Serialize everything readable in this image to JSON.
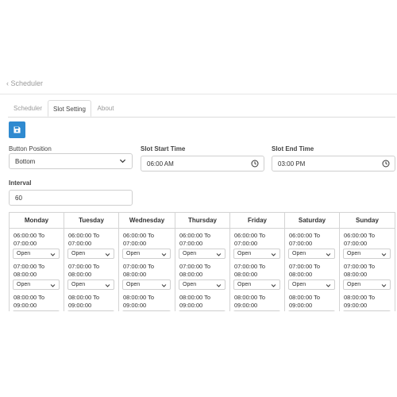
{
  "breadcrumb": "Scheduler",
  "tabs": [
    {
      "label": "Scheduler"
    },
    {
      "label": "Slot Setting"
    },
    {
      "label": "About"
    }
  ],
  "save_icon": "save-icon",
  "form": {
    "button_position": {
      "label": "Button Position",
      "value": "Bottom"
    },
    "slot_start_time": {
      "label": "Slot Start Time",
      "value": "06:00  AM"
    },
    "slot_end_time": {
      "label": "Slot End Time",
      "value": "03:00  PM"
    },
    "interval": {
      "label": "Interval",
      "value": "60"
    }
  },
  "schedule": {
    "days": [
      "Monday",
      "Tuesday",
      "Wednesday",
      "Thursday",
      "Friday",
      "Saturday",
      "Sunday"
    ],
    "slots": [
      {
        "time": "06:00:00 To 07:00:00",
        "status": "Open"
      },
      {
        "time": "07:00:00 To 08:00:00",
        "status": "Open"
      },
      {
        "time": "08:00:00 To 09:00:00",
        "status": "Open"
      }
    ]
  },
  "colors": {
    "accent": "#2f8ad0",
    "border": "#d4d4d4"
  }
}
